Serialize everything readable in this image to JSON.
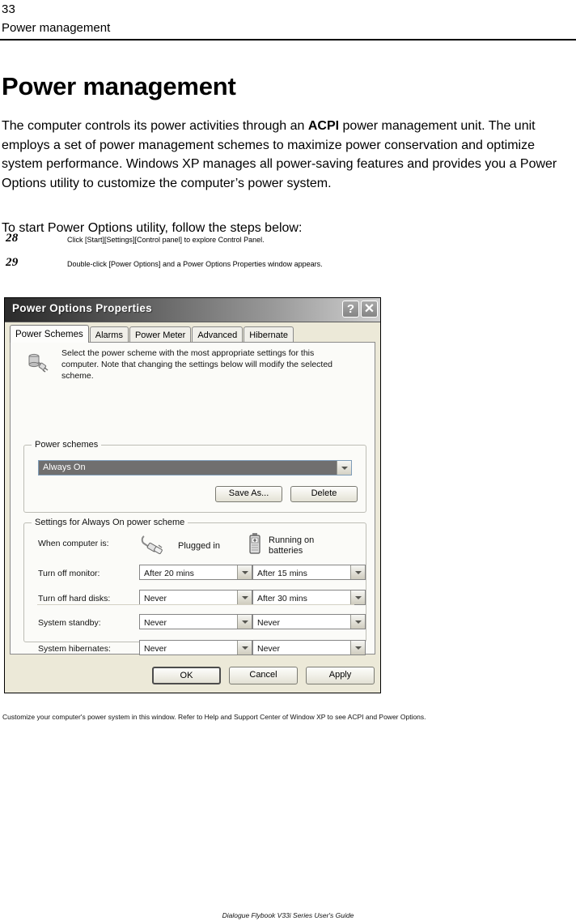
{
  "page": {
    "number": "33",
    "running_head": "Power management",
    "heading": "Power management",
    "footer": "Dialogue Flybook V33i Series User's Guide"
  },
  "body": {
    "paragraph_pre_bold": "The computer controls its power activities through an ",
    "paragraph_bold": "ACPI",
    "paragraph_post_bold": " power management unit. The unit employs a set of power management schemes to maximize power conservation and optimize system performance. Windows XP manages all power-saving features and provides you a Power Options utility to customize the computer’s power system.",
    "lead_in": "To start Power Options utility, follow the steps below:",
    "steps": [
      {
        "number": "28",
        "text": "Click [Start][Settings][Control panel] to explore Control Panel."
      },
      {
        "number": "29",
        "text": "Double-click [Power Options] and a Power Options Properties window appears."
      }
    ],
    "figure_caption": "Customize your computer's power system in this window. Refer to Help and Support Center of Window XP to see ACPI and Power Options."
  },
  "dialog": {
    "title": "Power Options Properties",
    "help_button": "?",
    "close_button": "✕",
    "tabs": [
      {
        "label": "Power Schemes",
        "active": true
      },
      {
        "label": "Alarms",
        "active": false
      },
      {
        "label": "Power Meter",
        "active": false
      },
      {
        "label": "Advanced",
        "active": false
      },
      {
        "label": "Hibernate",
        "active": false
      }
    ],
    "info_text": "Select the power scheme with the most appropriate settings for this computer. Note that changing the settings below will modify the selected scheme.",
    "schemes_group": {
      "title": "Power schemes",
      "selected_scheme": "Always On",
      "save_as_label": "Save As...",
      "delete_label": "Delete"
    },
    "settings_group": {
      "title": "Settings for Always On power scheme",
      "when_label": "When computer is:",
      "col_plugged": "Plugged in",
      "col_batteries": "Running on batteries",
      "rows": [
        {
          "label": "Turn off monitor:",
          "plugged": "After 20 mins",
          "batteries": "After 15 mins"
        },
        {
          "label": "Turn off hard disks:",
          "plugged": "Never",
          "batteries": "After 30 mins"
        },
        {
          "label": "System standby:",
          "plugged": "Never",
          "batteries": "Never"
        },
        {
          "label": "System hibernates:",
          "plugged": "Never",
          "batteries": "Never"
        }
      ]
    },
    "footer_buttons": {
      "ok": "OK",
      "cancel": "Cancel",
      "apply": "Apply"
    }
  },
  "colors": {
    "titlebar_dark": "#2b2b2b",
    "titlebar_light": "#cfcfcf",
    "dialog_face": "#ece9d8",
    "combo_selected_bg": "#706f6f"
  }
}
